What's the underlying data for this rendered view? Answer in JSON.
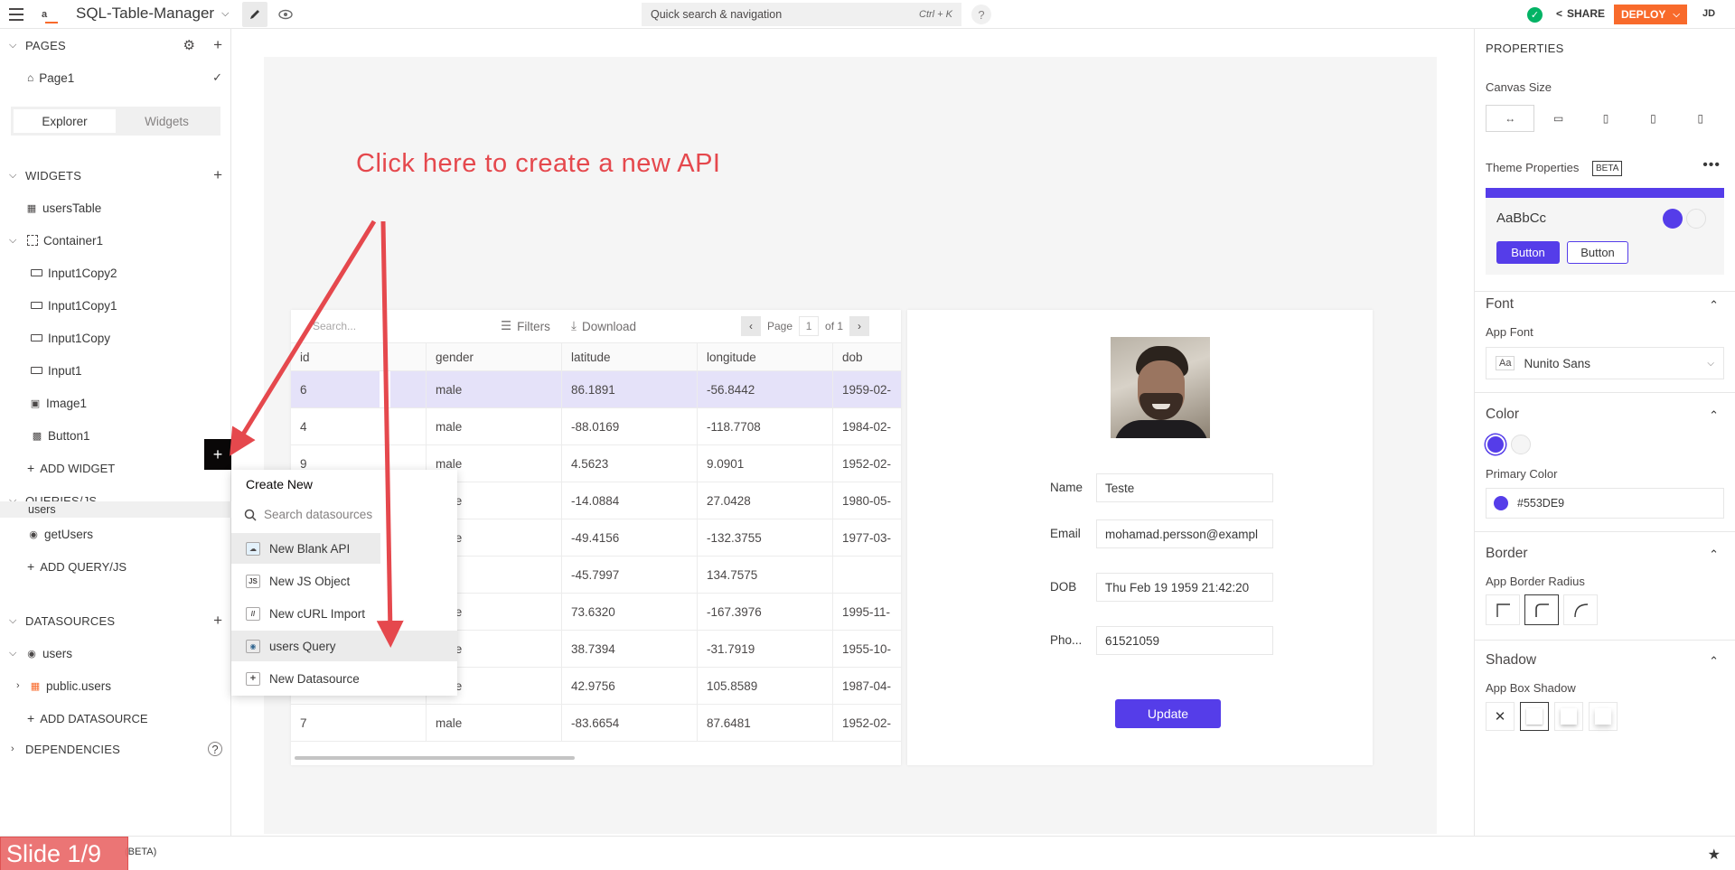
{
  "topbar": {
    "app_name": "SQL-Table-Manager",
    "search_placeholder": "Quick search & navigation",
    "search_shortcut": "Ctrl + K",
    "help": "?",
    "share_label": "SHARE",
    "deploy_label": "DEPLOY",
    "user_initials": "JD",
    "logo_text": "a"
  },
  "sidebar": {
    "pages_title": "PAGES",
    "page_item": "Page1",
    "tabs": [
      "Explorer",
      "Widgets"
    ],
    "widgets_title": "WIDGETS",
    "widgets": [
      "usersTable",
      "Container1",
      "Input1Copy2",
      "Input1Copy1",
      "Input1Copy",
      "Input1",
      "Image1",
      "Button1"
    ],
    "add_widget": "ADD WIDGET",
    "queries_title": "QUERIES/JS",
    "queries_group": "users",
    "query_item": "getUsers",
    "add_query": "ADD QUERY/JS",
    "datasources_title": "DATASOURCES",
    "datasource": "users",
    "datasource_table": "public.users",
    "add_datasource": "ADD DATASOURCE",
    "dependencies_title": "DEPENDENCIES"
  },
  "create_menu": {
    "title": "Create New",
    "search_placeholder": "Search datasources",
    "items": [
      "New Blank API",
      "New JS Object",
      "New cURL Import",
      "users Query",
      "New Datasource"
    ]
  },
  "canvas": {
    "callout": "Click here to create a new API"
  },
  "table": {
    "search_placeholder": "Search...",
    "filters_label": "Filters",
    "download_label": "Download",
    "page_label": "Page",
    "page_num": "1",
    "page_of": "of 1",
    "columns": [
      "id",
      "gender",
      "latitude",
      "longitude",
      "dob"
    ],
    "rows": [
      [
        "6",
        "male",
        "86.1891",
        "-56.8442",
        "1959-02-"
      ],
      [
        "4",
        "male",
        "-88.0169",
        "-118.7708",
        "1984-02-"
      ],
      [
        "9",
        "male",
        "4.5623",
        "9.0901",
        "1952-02-"
      ],
      [
        "",
        "male",
        "-14.0884",
        "27.0428",
        "1980-05-"
      ],
      [
        "",
        "male",
        "-49.4156",
        "-132.3755",
        "1977-03-"
      ],
      [
        "",
        "",
        "-45.7997",
        "134.7575",
        ""
      ],
      [
        "",
        "male",
        "73.6320",
        "-167.3976",
        "1995-11-"
      ],
      [
        "",
        "male",
        "38.7394",
        "-31.7919",
        "1955-10-"
      ],
      [
        "",
        "male",
        "42.9756",
        "105.8589",
        "1987-04-"
      ],
      [
        "7",
        "male",
        "-83.6654",
        "87.6481",
        "1952-02-"
      ]
    ]
  },
  "form": {
    "labels": [
      "Name",
      "Email",
      "DOB",
      "Pho..."
    ],
    "values": [
      "Teste",
      "mohamad.persson@exampl",
      "Thu Feb 19 1959 21:42:20",
      "61521059"
    ],
    "update_label": "Update"
  },
  "props": {
    "title": "PROPERTIES",
    "canvas_size": "Canvas Size",
    "theme_props": "Theme Properties",
    "beta": "BETA",
    "sample_text": "AaBbCc",
    "btn1": "Button",
    "btn2": "Button",
    "font_title": "Font",
    "app_font": "App Font",
    "font_value": "Nunito Sans",
    "font_badge": "Aa",
    "color_title": "Color",
    "primary_color": "Primary Color",
    "primary_color_value": "#553DE9",
    "border_title": "Border",
    "border_radius": "App Border Radius",
    "shadow_title": "Shadow",
    "box_shadow": "App Box Shadow"
  },
  "bottombar": {
    "slide_label": "Slide 1/9",
    "beta_tag": "(BETA)"
  },
  "colors": {
    "primary": "#553DE9",
    "accent_orange": "#F86A2B",
    "callout_red": "#E5484D",
    "success": "#03B365"
  }
}
